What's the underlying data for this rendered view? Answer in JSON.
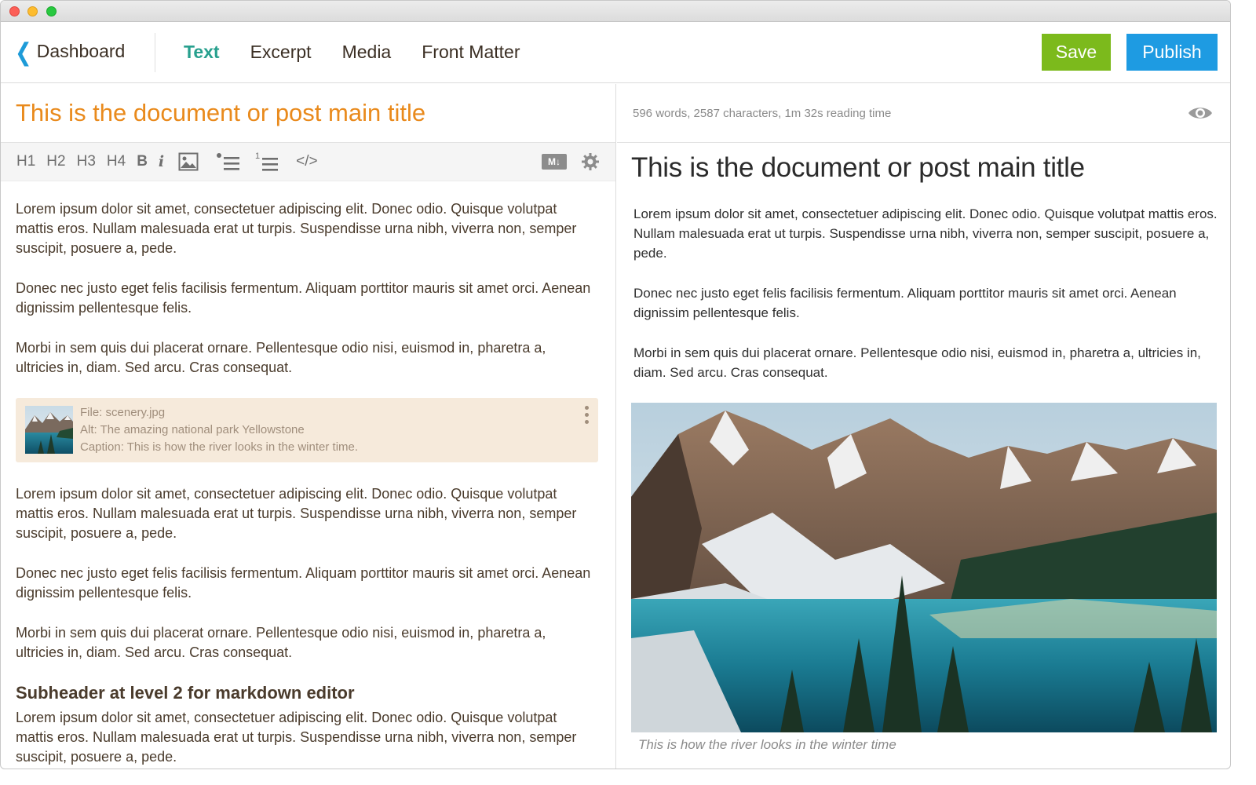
{
  "nav": {
    "back_label": "Dashboard",
    "tabs": [
      {
        "label": "Text",
        "active": true
      },
      {
        "label": "Excerpt",
        "active": false
      },
      {
        "label": "Media",
        "active": false
      },
      {
        "label": "Front Matter",
        "active": false
      }
    ],
    "save_label": "Save",
    "publish_label": "Publish"
  },
  "colors": {
    "accent_tab": "#28a08e",
    "title_orange": "#e98a1c",
    "save_green": "#7cba1c",
    "publish_blue": "#1e9be2",
    "back_chevron": "#1e9bd8"
  },
  "editor": {
    "title": "This is the document or post main title",
    "toolbar": {
      "h1": "H1",
      "h2": "H2",
      "h3": "H3",
      "h4": "H4",
      "bold": "B",
      "italic": "i",
      "code": "</>",
      "icons": [
        "image-icon",
        "bullet-list-icon",
        "numbered-list-icon",
        "markdown-icon",
        "gear-icon"
      ]
    },
    "paragraphs_before": [
      "Lorem ipsum dolor sit amet, consectetuer adipiscing elit. Donec odio. Quisque volutpat mattis eros. Nullam malesuada erat ut turpis. Suspendisse urna nibh, viverra non, semper suscipit, posuere a, pede.",
      "Donec nec justo eget felis facilisis fermentum. Aliquam porttitor mauris sit amet orci. Aenean dignissim pellentesque felis.",
      "Morbi in sem quis dui placerat ornare. Pellentesque odio nisi, euismod in, pharetra a, ultricies in, diam. Sed arcu. Cras consequat."
    ],
    "media": {
      "file": "File: scenery.jpg",
      "alt": "Alt: The amazing national park Yellowstone",
      "caption": "Caption: This is how the river looks in the winter time."
    },
    "paragraphs_after": [
      "Lorem ipsum dolor sit amet, consectetuer adipiscing elit. Donec odio. Quisque volutpat mattis eros. Nullam malesuada erat ut turpis. Suspendisse urna nibh, viverra non, semper suscipit, posuere a, pede.",
      "Donec nec justo eget felis facilisis fermentum. Aliquam porttitor mauris sit amet orci. Aenean dignissim pellentesque felis.",
      "Morbi in sem quis dui placerat ornare. Pellentesque odio nisi, euismod in, pharetra a, ultricies in, diam. Sed arcu. Cras consequat."
    ],
    "subheader": "Subheader at level 2 for markdown editor",
    "paragraph_last": "Lorem ipsum dolor sit amet, consectetuer adipiscing elit. Donec odio. Quisque volutpat mattis eros. Nullam malesuada erat ut turpis. Suspendisse urna nibh, viverra non, semper suscipit, posuere a, pede."
  },
  "preview": {
    "stats": "596 words, 2587 characters, 1m 32s reading time",
    "title": "This is the document or post main title",
    "paragraphs": [
      "Lorem ipsum dolor sit amet, consectetuer adipiscing elit. Donec odio. Quisque volutpat mattis eros. Nullam malesuada erat ut turpis. Suspendisse urna nibh, viverra non, semper suscipit, posuere a, pede.",
      "Donec nec justo eget felis facilisis fermentum. Aliquam porttitor mauris sit amet orci. Aenean dignissim pellentesque felis.",
      "Morbi in sem quis dui placerat ornare. Pellentesque odio nisi, euismod in, pharetra a, ultricies in, diam. Sed arcu. Cras consequat."
    ],
    "image_caption": "This is how the river looks in the winter time"
  }
}
